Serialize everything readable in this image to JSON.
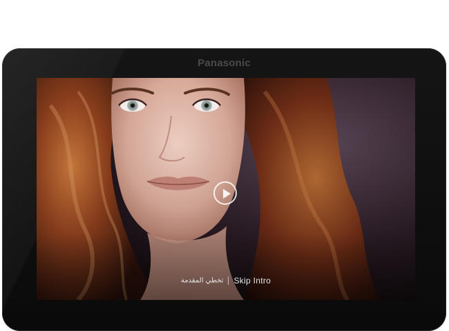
{
  "device": {
    "brand": "Panasonic"
  },
  "video": {
    "play_icon": "play-circle-icon",
    "skip_intro_arabic": "تخطي المقدمة",
    "skip_intro_english": "Skip Intro"
  },
  "colors": {
    "bezel": "#0f0f0f",
    "brand_text": "#4a4a4a",
    "overlay_text": "#e6e6e6"
  }
}
